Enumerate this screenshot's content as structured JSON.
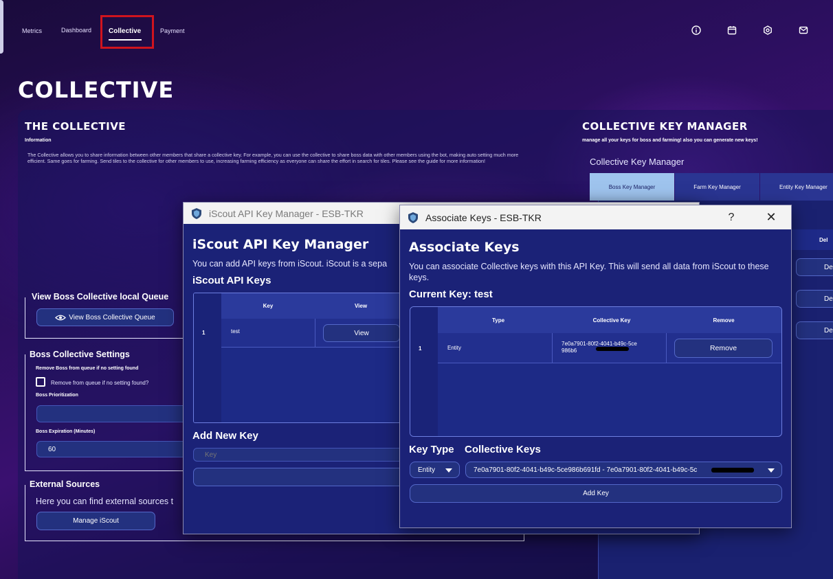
{
  "nav": {
    "items": [
      "Metrics",
      "Dashboard",
      "Collective",
      "Payment"
    ],
    "active": "Collective"
  },
  "page": {
    "title": "COLLECTIVE"
  },
  "collective": {
    "title": "THE COLLECTIVE",
    "info_label": "Information",
    "info_text": "The Collective allows you to share information between other members that share a collective key. For example, you can use the collective to share boss data with other members using the bot, making auto setting much more efficient. Same goes for farming. Send tiles to the collective for other members to use, increasing farming efficiency as everyone can share the effort in search for tiles. Please see the guide for more information!"
  },
  "boss_queue": {
    "title": "View Boss Collective  local Queue",
    "button": "View Boss Collective Queue"
  },
  "boss_settings": {
    "title": "Boss Collective Settings",
    "remove_label": "Remove Boss from queue if no setting found",
    "remove_checkbox": "Remove from queue if no setting found?",
    "prioritization_label": "Boss Prioritization",
    "expiration_label": "Boss Expiration (Minutes)",
    "expiration_value": "60"
  },
  "external": {
    "title": "External Sources",
    "text": "Here you can find external sources t",
    "button": "Manage iScout"
  },
  "key_manager": {
    "title": "COLLECTIVE KEY MANAGER",
    "subtitle": "manage all your keys for boss and farming! also you can generate new keys!",
    "section": "Collective Key Manager",
    "tabs": [
      "Boss Key Manager",
      "Farm Key Manager",
      "Entity Key Manager"
    ],
    "col_partial": "Del",
    "btn_partial": "De"
  },
  "iscout_window": {
    "title": "iScout API Key Manager - ESB-TKR",
    "heading": "iScout API Key Manager",
    "desc": "You can add API keys from iScout. iScout is a sepa",
    "keys_title": "iScout API Keys",
    "columns": [
      "Key",
      "View"
    ],
    "rows": [
      {
        "num": "1",
        "key": "test",
        "view": "View"
      }
    ],
    "add_title": "Add New Key",
    "key_placeholder": "Key"
  },
  "associate_window": {
    "title": "Associate Keys - ESB-TKR",
    "help": "?",
    "close": "✕",
    "heading": "Associate Keys",
    "desc": "You can associate Collective keys with this API Key. This will send all data from iScout to these keys.",
    "current_key": "Current Key: test",
    "columns": [
      "Type",
      "Collective Key",
      "Remove"
    ],
    "rows": [
      {
        "num": "1",
        "type": "Entity",
        "key": "7e0a7901-80f2-4041-b49c-5ce986b6",
        "remove": "Remove"
      }
    ],
    "key_type_label": "Key Type",
    "collective_keys_label": "Collective Keys",
    "type_value": "Entity",
    "collective_value": "7e0a7901-80f2-4041-b49c-5ce986b691fd - 7e0a7901-80f2-4041-b49c-5c",
    "add_button": "Add Key"
  }
}
